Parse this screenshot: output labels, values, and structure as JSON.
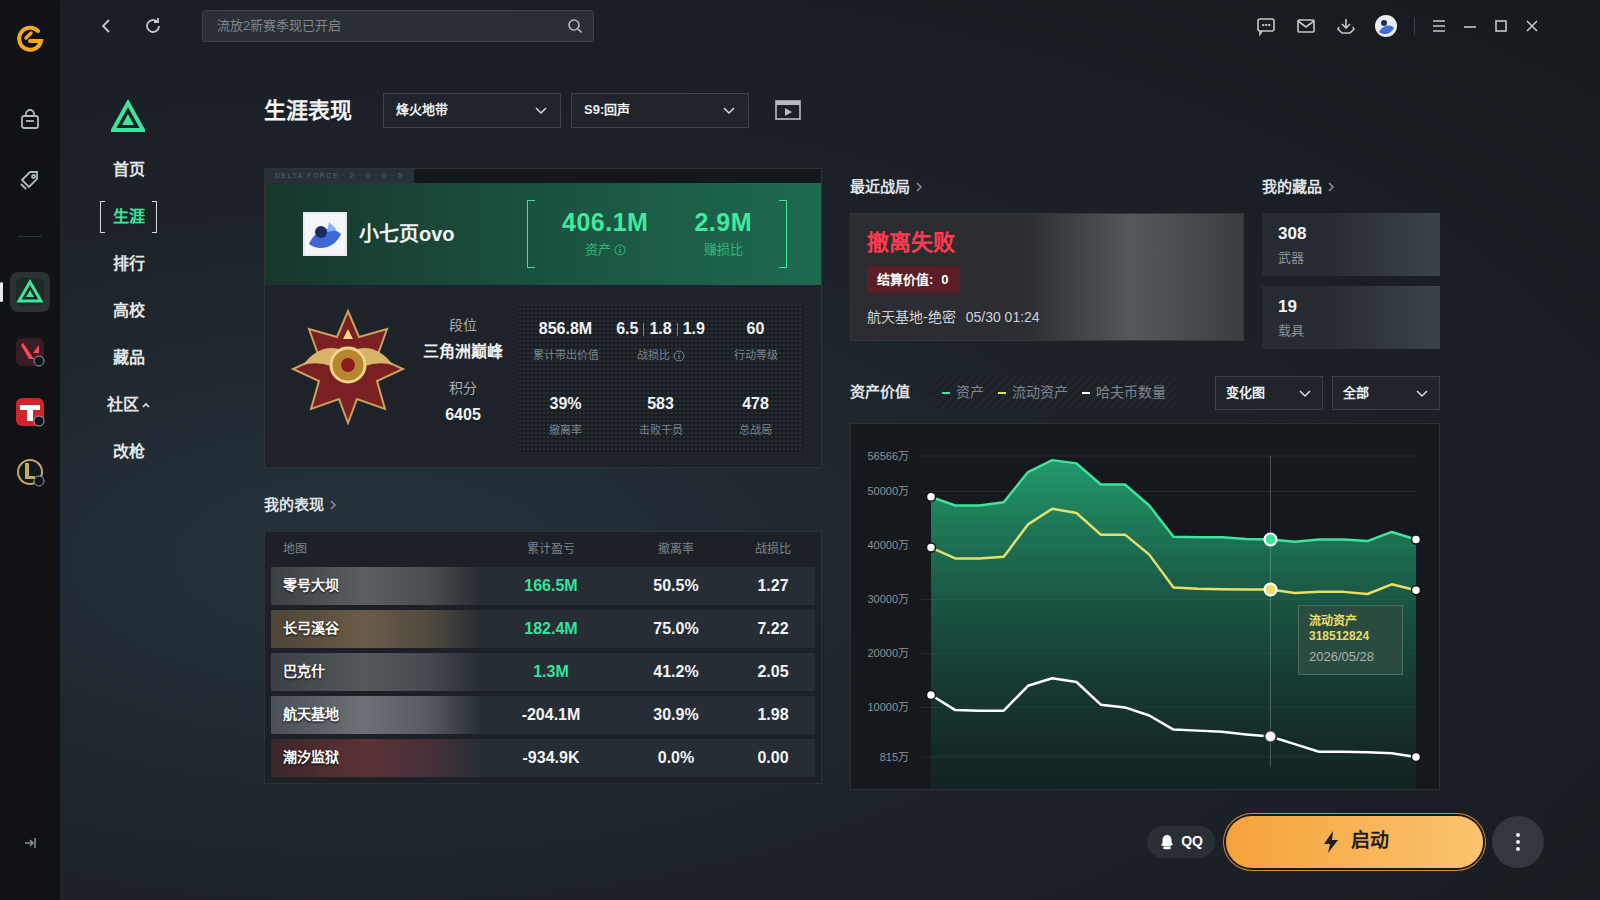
{
  "top_bar": {
    "search": {
      "placeholder": "流放2新赛季现已开启"
    }
  },
  "rail": {
    "items": [
      {
        "selected": false
      },
      {
        "selected": false
      },
      {
        "selected": true
      },
      {
        "selected": false
      },
      {
        "selected": false
      },
      {
        "selected": false
      }
    ]
  },
  "sidebar": {
    "items": [
      {
        "label": "首页",
        "selected": false,
        "kind": "link"
      },
      {
        "label": "生涯",
        "selected": true,
        "kind": "link"
      },
      {
        "label": "排行",
        "selected": false,
        "kind": "link"
      },
      {
        "label": "高校",
        "selected": false,
        "kind": "link"
      },
      {
        "label": "藏品",
        "selected": false,
        "kind": "link"
      },
      {
        "label": "社区",
        "selected": false,
        "kind": "group",
        "expanded": true
      },
      {
        "label": "改枪",
        "selected": false,
        "kind": "link"
      }
    ]
  },
  "header": {
    "title": "生涯表现",
    "filters": [
      {
        "label": "烽火地带"
      },
      {
        "label": "S9:回声"
      }
    ]
  },
  "profile": {
    "banner": "DELTA FORCE · 2 · 0 · 0 · 5",
    "name": "小七页ovo",
    "highlights": [
      {
        "value": "406.1M",
        "label": "资产",
        "info_icon": true
      },
      {
        "value": "2.9M",
        "label": "赚损比",
        "info_icon": false
      }
    ],
    "rank": {
      "label": "段位",
      "value": "三角洲巅峰",
      "score_label": "积分",
      "score": "6405"
    },
    "stats": [
      {
        "values": [
          "856.8M"
        ],
        "label": "累计带出价值",
        "info_icon": false
      },
      {
        "values": [
          "6.5",
          "1.8",
          "1.9"
        ],
        "label": "战损比",
        "info_icon": true
      },
      {
        "values": [
          "60"
        ],
        "label": "行动等级",
        "info_icon": false
      },
      {
        "values": [
          "39%"
        ],
        "label": "撤离率",
        "info_icon": false
      },
      {
        "values": [
          "583"
        ],
        "label": "击败干员",
        "info_icon": false
      },
      {
        "values": [
          "478"
        ],
        "label": "总战局",
        "info_icon": false
      }
    ]
  },
  "performance": {
    "title": "我的表现",
    "columns": [
      "地图",
      "累计盈亏",
      "撤离率",
      "战损比"
    ],
    "rows": [
      {
        "map": "零号大坝",
        "profit": "166.5M",
        "rate": "50.5%",
        "kd": "1.27",
        "positive": true
      },
      {
        "map": "长弓溪谷",
        "profit": "182.4M",
        "rate": "75.0%",
        "kd": "7.22",
        "positive": true
      },
      {
        "map": "巴克什",
        "profit": "1.3M",
        "rate": "41.2%",
        "kd": "2.05",
        "positive": true
      },
      {
        "map": "航天基地",
        "profit": "-204.1M",
        "rate": "30.9%",
        "kd": "1.98",
        "positive": false
      },
      {
        "map": "潮汐监狱",
        "profit": "-934.9K",
        "rate": "0.0%",
        "kd": "0.00",
        "positive": false
      }
    ]
  },
  "recent": {
    "title": "最近战局",
    "result": "撤离失败",
    "value_label": "结算价值:",
    "value": "0",
    "map": "航天基地-绝密",
    "time": "05/30 01:24"
  },
  "collection": {
    "title": "我的藏品",
    "items": [
      {
        "count": "308",
        "label": "武器"
      },
      {
        "count": "19",
        "label": "载具"
      }
    ]
  },
  "chart": {
    "title": "资产价值",
    "series": [
      {
        "label": "资产",
        "color": "#3fe39b",
        "values": [
          49000,
          47400,
          47400,
          48000,
          53600,
          55800,
          55200,
          51300,
          51300,
          47400,
          41600,
          41500,
          41500,
          41200,
          41100,
          40700,
          41100,
          41100,
          40800,
          42500,
          41100
        ]
      },
      {
        "label": "流动资产",
        "color": "#e6df6a",
        "values": [
          39600,
          37600,
          37600,
          37900,
          43900,
          46800,
          46000,
          42000,
          42000,
          38300,
          32200,
          32000,
          31900,
          31850,
          31851,
          31200,
          31400,
          31400,
          31000,
          32800,
          31700
        ]
      },
      {
        "label": "哈夫币数量",
        "color": "#ffffff",
        "values": [
          12300,
          9500,
          9400,
          9400,
          14000,
          15400,
          14700,
          10500,
          10000,
          8500,
          5900,
          5700,
          5500,
          5000,
          4600,
          3200,
          1800,
          1800,
          1700,
          1500,
          815
        ]
      }
    ],
    "selects": [
      {
        "label": "变化图"
      },
      {
        "label": "全部"
      }
    ],
    "y_ticks": [
      {
        "label": "56566万",
        "value": 56566
      },
      {
        "label": "50000万",
        "value": 50000
      },
      {
        "label": "40000万",
        "value": 40000
      },
      {
        "label": "30000万",
        "value": 30000
      },
      {
        "label": "20000万",
        "value": 20000
      },
      {
        "label": "10000万",
        "value": 10000
      },
      {
        "label": "815万",
        "value": 815
      }
    ],
    "hover_index": 14,
    "tooltip": {
      "title": "流动资产",
      "value": "318512824",
      "date": "2026/05/28"
    }
  },
  "footer": {
    "qq": "QQ",
    "launch": "启动"
  }
}
